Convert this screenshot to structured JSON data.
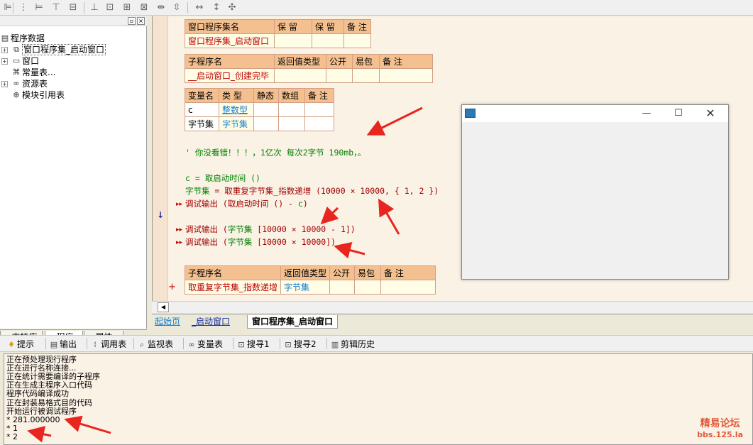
{
  "toolbar": {
    "icons": [
      "align-left-icon",
      "align-center-icon",
      "align-right-icon",
      "align-top-icon",
      "align-middle-icon",
      "align-bottom-icon",
      "same-width-icon",
      "same-height-icon",
      "same-size-icon",
      "h-space-icon",
      "v-space-icon",
      "center-h-icon",
      "center-v-icon",
      "center-both-icon"
    ]
  },
  "left_panel": {
    "tree": [
      {
        "label": "程序数据",
        "icon": "data-icon",
        "level": 0
      },
      {
        "label": "窗口程序集_启动窗口",
        "icon": "assembly-icon",
        "level": 1,
        "selected": true
      },
      {
        "label": "窗口",
        "icon": "window-icon",
        "level": 1
      },
      {
        "label": "常量表...",
        "icon": "constant-icon",
        "level": 1
      },
      {
        "label": "资源表",
        "icon": "resource-icon",
        "level": 1
      },
      {
        "label": "模块引用表",
        "icon": "module-icon",
        "level": 1
      }
    ],
    "tabs": [
      "支持库",
      "程序",
      "属性"
    ]
  },
  "editor": {
    "assembly_table": {
      "headers": [
        "窗口程序集名",
        "保 留",
        "保 留",
        "备 注"
      ],
      "row": [
        "窗口程序集_启动窗口",
        "",
        "",
        ""
      ]
    },
    "sub1_table": {
      "headers": [
        "子程序名",
        "返回值类型",
        "公开",
        "易包",
        "备 注"
      ],
      "row": [
        "__启动窗口_创建完毕",
        "",
        "",
        "",
        ""
      ]
    },
    "var_table": {
      "headers": [
        "变量名",
        "类 型",
        "静态",
        "数组",
        "备 注"
      ],
      "rows": [
        [
          "c",
          "整数型",
          "",
          "",
          ""
        ],
        [
          "字节集",
          "字节集",
          "",
          "",
          ""
        ]
      ]
    },
    "code": {
      "comment": "' 你没看错！！！，1亿次 每次2字节 190mb，。",
      "line1": "c = 取启动时间 ()",
      "line2_var": "字节集",
      "line2_rest": " = 取重复字节集_指数递增 (10000 × 10000, { 1, 2 })",
      "line3_fn": "调试输出 (",
      "line3_arg": "取启动时间 () - ",
      "line3_var": "c",
      "line3_end": ")",
      "line4_fn": "调试输出 (",
      "line4_var": "字节集",
      "line4_rest": " [10000 × 10000 - 1])",
      "line5_fn": "调试输出 (",
      "line5_var": "字节集",
      "line5_rest": " [10000 × 10000])"
    },
    "sub2_table": {
      "headers": [
        "子程序名",
        "返回值类型",
        "公开",
        "易包",
        "备 注"
      ],
      "row": [
        "取重复字节集_指数递增",
        "字节集",
        "",
        "",
        ""
      ]
    },
    "tabs": [
      "起始页",
      "_启动窗口",
      "窗口程序集_启动窗口"
    ],
    "gutter_arrow": "↓",
    "plus_marker": "+",
    "line_marker": "▸▸"
  },
  "bottom_toolbar": {
    "buttons": [
      {
        "label": "提示",
        "icon": "hint-icon"
      },
      {
        "label": "输出",
        "icon": "output-icon"
      },
      {
        "label": "调用表",
        "icon": "call-stack-icon"
      },
      {
        "label": "监视表",
        "icon": "watch-icon"
      },
      {
        "label": "变量表",
        "icon": "variables-icon"
      },
      {
        "label": "搜寻1",
        "icon": "search1-icon"
      },
      {
        "label": "搜寻2",
        "icon": "search2-icon"
      },
      {
        "label": "剪辑历史",
        "icon": "clip-history-icon"
      }
    ]
  },
  "output": {
    "lines": [
      "正在预处理现行程序",
      "正在进行名称连接...",
      "正在统计需要编译的子程序",
      "正在生成主程序入口代码",
      "程序代码编译成功",
      "正在封装易格式目的代码",
      "开始运行被调试程序",
      "* 281.000000",
      "* 1",
      "* 2"
    ]
  },
  "watermark": {
    "line1": "精易论坛",
    "line2": "bbs.125.la"
  },
  "colors": {
    "header": "#f4c08f",
    "row": "#fffde6",
    "editor_bg": "#fbf2e6",
    "arrow": "#e8251e"
  }
}
